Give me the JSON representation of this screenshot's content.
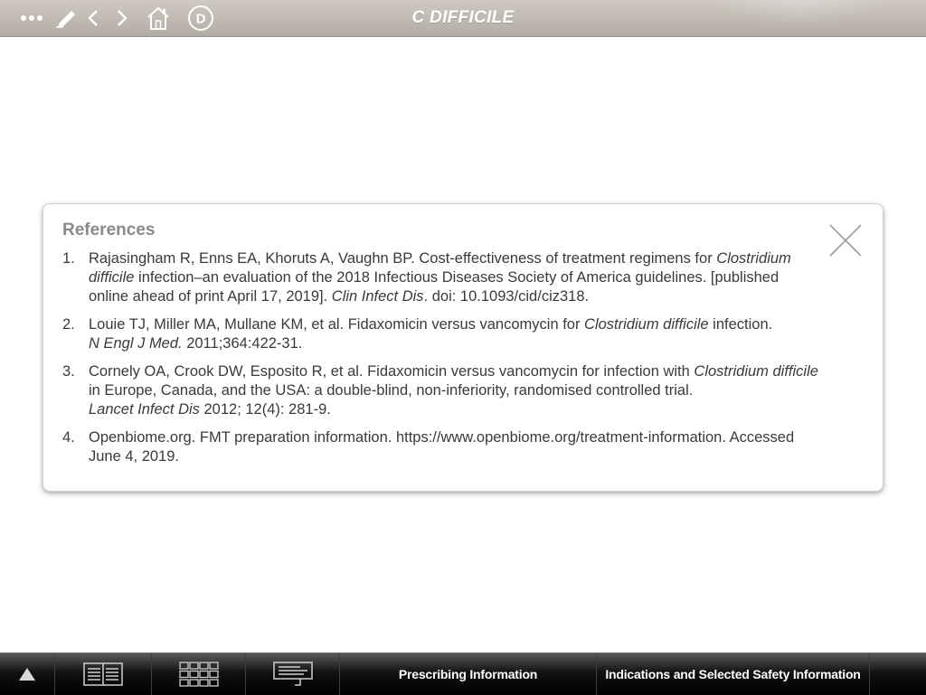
{
  "header": {
    "title": "C DIFFICILE",
    "icons": [
      "more-icon",
      "pencil-icon",
      "back-arrow-icon",
      "forward-arrow-icon",
      "home-icon",
      "d-circle-icon"
    ],
    "d_label": "D"
  },
  "modal": {
    "title": "References",
    "close_icon": "close-icon",
    "references": [
      {
        "number": "1.",
        "t1": "Rajasingham R, Enns EA, Khoruts A, Vaughn BP. Cost-effectiveness of treatment regimens for ",
        "i1": "Clostridium difficile",
        "t2": " infection–an evaluation of the 2018 Infectious Diseases Society of America guidelines. [published online ahead of print April 17, 2019]. ",
        "i2": "Clin Infect Dis",
        "t3": ". doi: 10.1093/cid/ciz318."
      },
      {
        "number": "2.",
        "t1": "Louie TJ, Miller MA, Mullane KM, et al. Fidaxomicin versus vancomycin for ",
        "i1": "Clostridium difficile",
        "t2": " infection. ",
        "i2": "N Engl J Med.",
        "t3": " 2011;364:422-31."
      },
      {
        "number": "3.",
        "t1": "Cornely OA, Crook DW, Esposito R, et al. Fidaxomicin versus vancomycin for infection with ",
        "i1": "Clostridium difficile",
        "t2": " in Europe, Canada, and the USA: a double-blind, non-inferiority, randomised controlled trial. ",
        "i2": "Lancet Infect Dis",
        "t3": " 2012; 12(4): 281-9."
      },
      {
        "number": "4.",
        "t1": "Openbiome.org. FMT preparation information. https://www.openbiome.org/treatment-information. Accessed June 4, 2019.",
        "i1": "",
        "t2": "",
        "i2": "",
        "t3": ""
      }
    ]
  },
  "footer": {
    "icons": [
      "up-triangle-icon",
      "book-icon",
      "grid-icon",
      "notes-icon"
    ],
    "prescribing_label": "Prescribing Information",
    "safety_label": "Indications and Selected Safety Information"
  },
  "colors": {
    "topbar": "#bdb6ae",
    "bottombar": "#111111",
    "modal_title": "#8a8a8a",
    "body_text": "#3a3a3a"
  }
}
